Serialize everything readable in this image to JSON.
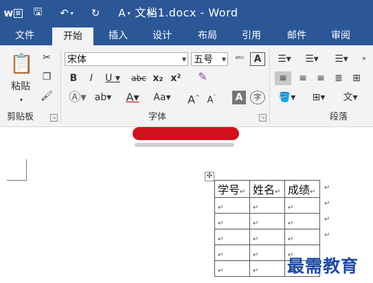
{
  "window": {
    "title": "文档1.docx - Word",
    "accent": "#2b5797"
  },
  "quick_access": {
    "icons": [
      "word-logo-icon",
      "save-icon",
      "undo-icon",
      "redo-icon",
      "format-painter-icon",
      "customize-icon"
    ]
  },
  "tabs": [
    {
      "label": "文件",
      "active": false
    },
    {
      "label": "开始",
      "active": true
    },
    {
      "label": "插入",
      "active": false
    },
    {
      "label": "设计",
      "active": false
    },
    {
      "label": "布局",
      "active": false
    },
    {
      "label": "引用",
      "active": false
    },
    {
      "label": "邮件",
      "active": false
    },
    {
      "label": "审阅",
      "active": false
    }
  ],
  "ribbon": {
    "clipboard": {
      "paste_label": "粘贴",
      "group_label": "剪贴板"
    },
    "font": {
      "font_name": "宋体",
      "font_size": "五号",
      "group_label": "字体"
    },
    "paragraph": {
      "group_label": "段落"
    }
  },
  "table": {
    "headers": [
      "学号",
      "姓名",
      "成绩"
    ],
    "rows": [
      [
        "↵",
        "↵",
        "↵"
      ],
      [
        "↵",
        "↵",
        "↵"
      ],
      [
        "↵",
        "↵",
        "↵"
      ],
      [
        "↵",
        "↵",
        "↵"
      ],
      [
        "↵",
        "↵",
        "↵"
      ]
    ],
    "cell_mark": "↵",
    "move_handle": "✣"
  },
  "watermark": "最需教育"
}
